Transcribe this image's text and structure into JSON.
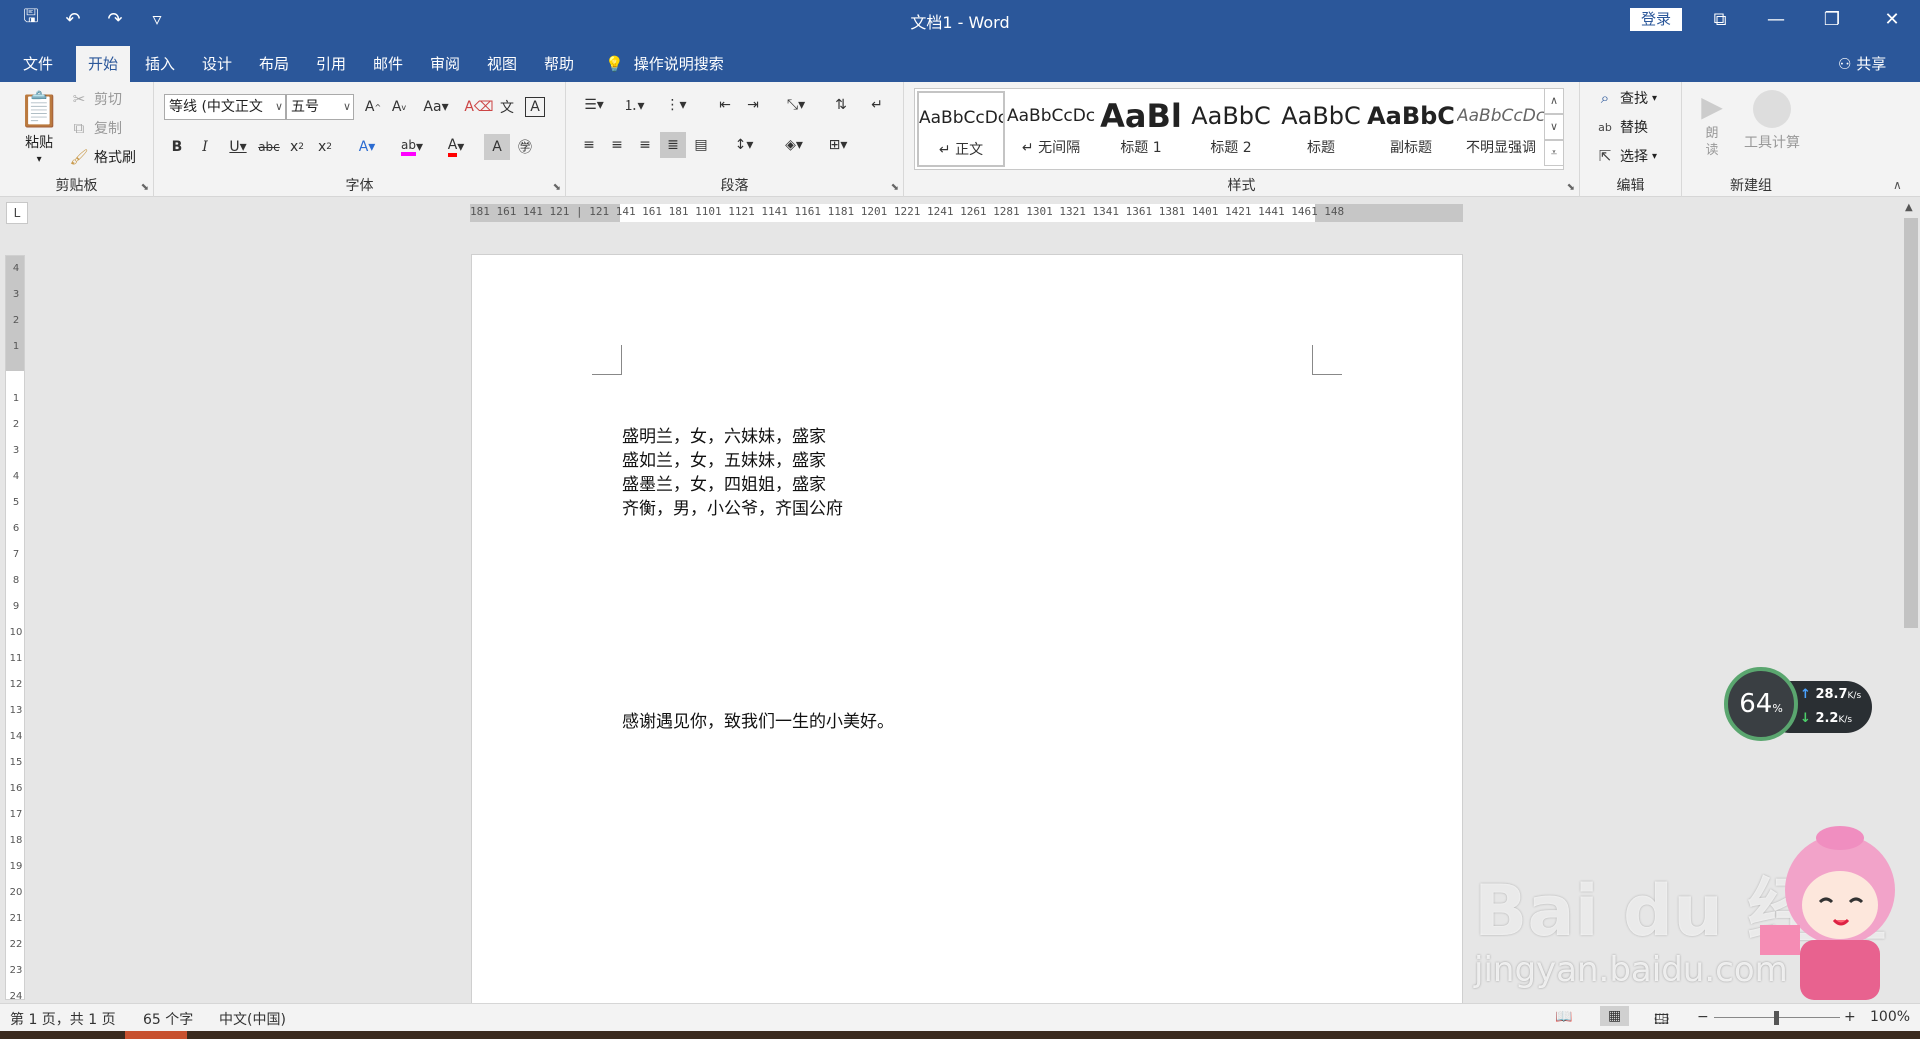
{
  "titlebar": {
    "title": "文档1  -  Word",
    "login": "登录",
    "qat": {
      "save": "🖫",
      "undo": "↶",
      "redo": "↷",
      "customize": "▿"
    },
    "controls": {
      "ribbon_options": "⧉",
      "minimize": "—",
      "restore": "❐",
      "close": "✕"
    }
  },
  "tabs": [
    {
      "label": "文件"
    },
    {
      "label": "开始"
    },
    {
      "label": "插入"
    },
    {
      "label": "设计"
    },
    {
      "label": "布局"
    },
    {
      "label": "引用"
    },
    {
      "label": "邮件"
    },
    {
      "label": "审阅"
    },
    {
      "label": "视图"
    },
    {
      "label": "帮助"
    }
  ],
  "tellme": "操作说明搜索",
  "share": "共享",
  "clipboard": {
    "label": "剪贴板",
    "paste": "粘贴",
    "cut": "剪切",
    "copy": "复制",
    "format_painter": "格式刷"
  },
  "font": {
    "label": "字体",
    "font_name": "等线 (中文正文",
    "font_size": "五号"
  },
  "paragraph": {
    "label": "段落"
  },
  "styles": {
    "label": "样式",
    "items": [
      {
        "preview": "AaBbCcDc",
        "name": "↵ 正文"
      },
      {
        "preview": "AaBbCcDc",
        "name": "↵ 无间隔"
      },
      {
        "preview": "AaBl",
        "name": "标题 1"
      },
      {
        "preview": "AaBbC",
        "name": "标题 2"
      },
      {
        "preview": "AaBbC",
        "name": "标题"
      },
      {
        "preview": "AaBbC",
        "name": "副标题"
      },
      {
        "preview": "AaBbCcDc",
        "name": "不明显强调"
      }
    ]
  },
  "editing": {
    "label": "编辑",
    "find": "查找",
    "replace": "替换",
    "select": "选择"
  },
  "newgroup": {
    "label": "新建组",
    "read_aloud": "朗读",
    "tool_calc": "工具计算"
  },
  "ruler": {
    "corner": "L",
    "h_ticks": "181 161 141 121  |  121 141 161 181 1101 1121 1141 1161 1181 1201 1221 1241 1261 1281 1301 1321 1341 1361 1381 1401 1421 1441 1461 148",
    "v_ticks": [
      "4",
      "3",
      "2",
      "1",
      "",
      "1",
      "2",
      "3",
      "4",
      "5",
      "6",
      "7",
      "8",
      "9",
      "10",
      "11",
      "12",
      "13",
      "14",
      "15",
      "16",
      "17",
      "18",
      "19",
      "20",
      "21",
      "22",
      "23",
      "24"
    ]
  },
  "document": {
    "lines": [
      "盛明兰，女，六妹妹，盛家",
      "盛如兰，女，五妹妹，盛家",
      "盛墨兰，女，四姐姐，盛家",
      "齐衡，男，小公爷，齐国公府",
      "感谢遇见你，致我们一生的小美好。"
    ]
  },
  "net_widget": {
    "percent": "64",
    "percent_unit": "%",
    "up": "28.7",
    "down": "2.2",
    "unit": "K/s"
  },
  "watermark": {
    "text": "Bai du 经验",
    "url": "jingyan.baidu.com"
  },
  "statusbar": {
    "page": "第 1 页，共 1 页",
    "words": "65 个字",
    "language": "中文(中国)",
    "zoom": "100%"
  },
  "colors": {
    "brand": "#2b579a",
    "ribbon_bg": "#f3f3f3",
    "canvas_bg": "#e6e6e6",
    "highlight": "#ff00ff",
    "font_color": "#ff0000"
  }
}
